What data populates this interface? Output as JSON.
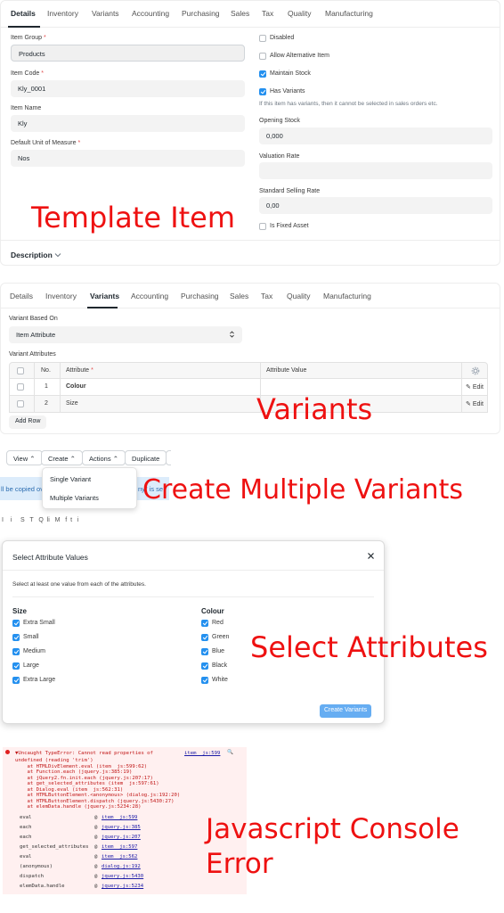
{
  "item_form": {
    "tabs": [
      "Details",
      "Inventory",
      "Variants",
      "Accounting",
      "Purchasing",
      "Sales",
      "Tax",
      "Quality",
      "Manufacturing"
    ],
    "active_tab": "Details",
    "fields": {
      "item_group": {
        "label": "Item Group",
        "value": "Products"
      },
      "item_code": {
        "label": "Item Code",
        "value": "Kly_0001"
      },
      "item_name": {
        "label": "Item Name",
        "value": "Kly"
      },
      "uom": {
        "label": "Default Unit of Measure",
        "value": "Nos"
      },
      "opening_stock": {
        "label": "Opening Stock",
        "value": "0,000"
      },
      "valuation_rate": {
        "label": "Valuation Rate",
        "value": ""
      },
      "selling_rate": {
        "label": "Standard Selling Rate",
        "value": "0,00"
      }
    },
    "required_mark": "*",
    "checks": {
      "disabled": {
        "label": "Disabled",
        "checked": false
      },
      "allow_alt": {
        "label": "Allow Alternative Item",
        "checked": false
      },
      "maintain_stock": {
        "label": "Maintain Stock",
        "checked": true
      },
      "has_variants": {
        "label": "Has Variants",
        "checked": true
      },
      "fixed_asset": {
        "label": "Is Fixed Asset",
        "checked": false
      }
    },
    "has_variants_hint": "If this item has variants, then it cannot be selected in sales orders etc.",
    "description_section": "Description"
  },
  "variants_form": {
    "tabs": [
      "Details",
      "Inventory",
      "Variants",
      "Accounting",
      "Purchasing",
      "Sales",
      "Tax",
      "Quality",
      "Manufacturing"
    ],
    "active_tab": "Variants",
    "variant_based_on": {
      "label": "Variant Based On",
      "value": "Item Attribute"
    },
    "attributes_label": "Variant Attributes",
    "columns": {
      "no": "No.",
      "attribute": "Attribute",
      "value": "Attribute Value"
    },
    "rows": [
      {
        "no": "1",
        "attribute": "Colour",
        "edit": "Edit"
      },
      {
        "no": "2",
        "attribute": "Size",
        "edit": "Edit"
      }
    ],
    "add_row": "Add Row"
  },
  "toolbar": {
    "view": "View",
    "create": "Create",
    "actions": "Actions",
    "duplicate": "Duplicate",
    "menu": [
      "Single Variant",
      "Multiple Variants"
    ],
    "bg_fragment_left": "ll be copied ov",
    "bg_fragment_right": "ny\" is se",
    "bg_fragment_bottom": "I    i     S   T   Q  li   M   f  t   i"
  },
  "modal": {
    "title": "Select Attribute Values",
    "subtitle": "Select at least one value from each of the attributes.",
    "groups": [
      {
        "name": "Size",
        "options": [
          "Extra Small",
          "Small",
          "Medium",
          "Large",
          "Extra Large"
        ]
      },
      {
        "name": "Colour",
        "options": [
          "Red",
          "Green",
          "Blue",
          "Black",
          "White"
        ]
      }
    ],
    "submit": "Create Variants"
  },
  "console": {
    "header": "▼Uncaught TypeError: Cannot read properties of",
    "header_link": "item  js:599",
    "lines": [
      "undefined (reading 'trim')",
      "    at HTMLDivElement.eval (item  js:599:62)",
      "    at Function.each (jquery.js:385:19)",
      "    at jQuery2.fn.init.each (jquery.js:207:17)",
      "    at get_selected_attributes (item  js:597:61)",
      "    at Dialog.eval (item  js:562:31)",
      "    at HTMLButtonElement.<anonymous> (dialog.js:192:20)",
      "    at HTMLButtonElement.dispatch (jquery.js:5430:27)",
      "    at elemData.handle (jquery.js:5234:28)"
    ],
    "stack": [
      {
        "fn": "eval",
        "loc": "item  js:599"
      },
      {
        "fn": "each",
        "loc": "jquery.js:385"
      },
      {
        "fn": "each",
        "loc": "jquery.js:207"
      },
      {
        "fn": "get_selected_attributes",
        "loc": "item  js:597"
      },
      {
        "fn": "eval",
        "loc": "item  js:562"
      },
      {
        "fn": "(anonymous)",
        "loc": "dialog.js:192"
      },
      {
        "fn": "dispatch",
        "loc": "jquery.js:5430"
      },
      {
        "fn": "elemData.handle",
        "loc": "jquery.js:5234"
      }
    ]
  },
  "annotations": {
    "template_item": "Template Item",
    "variants": "Variants",
    "create_multiple": "Create Multiple Variants",
    "select_attributes": "Select Attributes",
    "console_error_1": "Javascript Console",
    "console_error_2": "Error"
  },
  "colors": {
    "primary": "#2490ef",
    "annotation": "#ee1111",
    "console_bg": "#fff0f0"
  },
  "icons": [
    "chevron-down-icon",
    "select-arrows-icon",
    "close-icon",
    "gear-icon",
    "edit-icon",
    "error-icon",
    "search-icon"
  ]
}
